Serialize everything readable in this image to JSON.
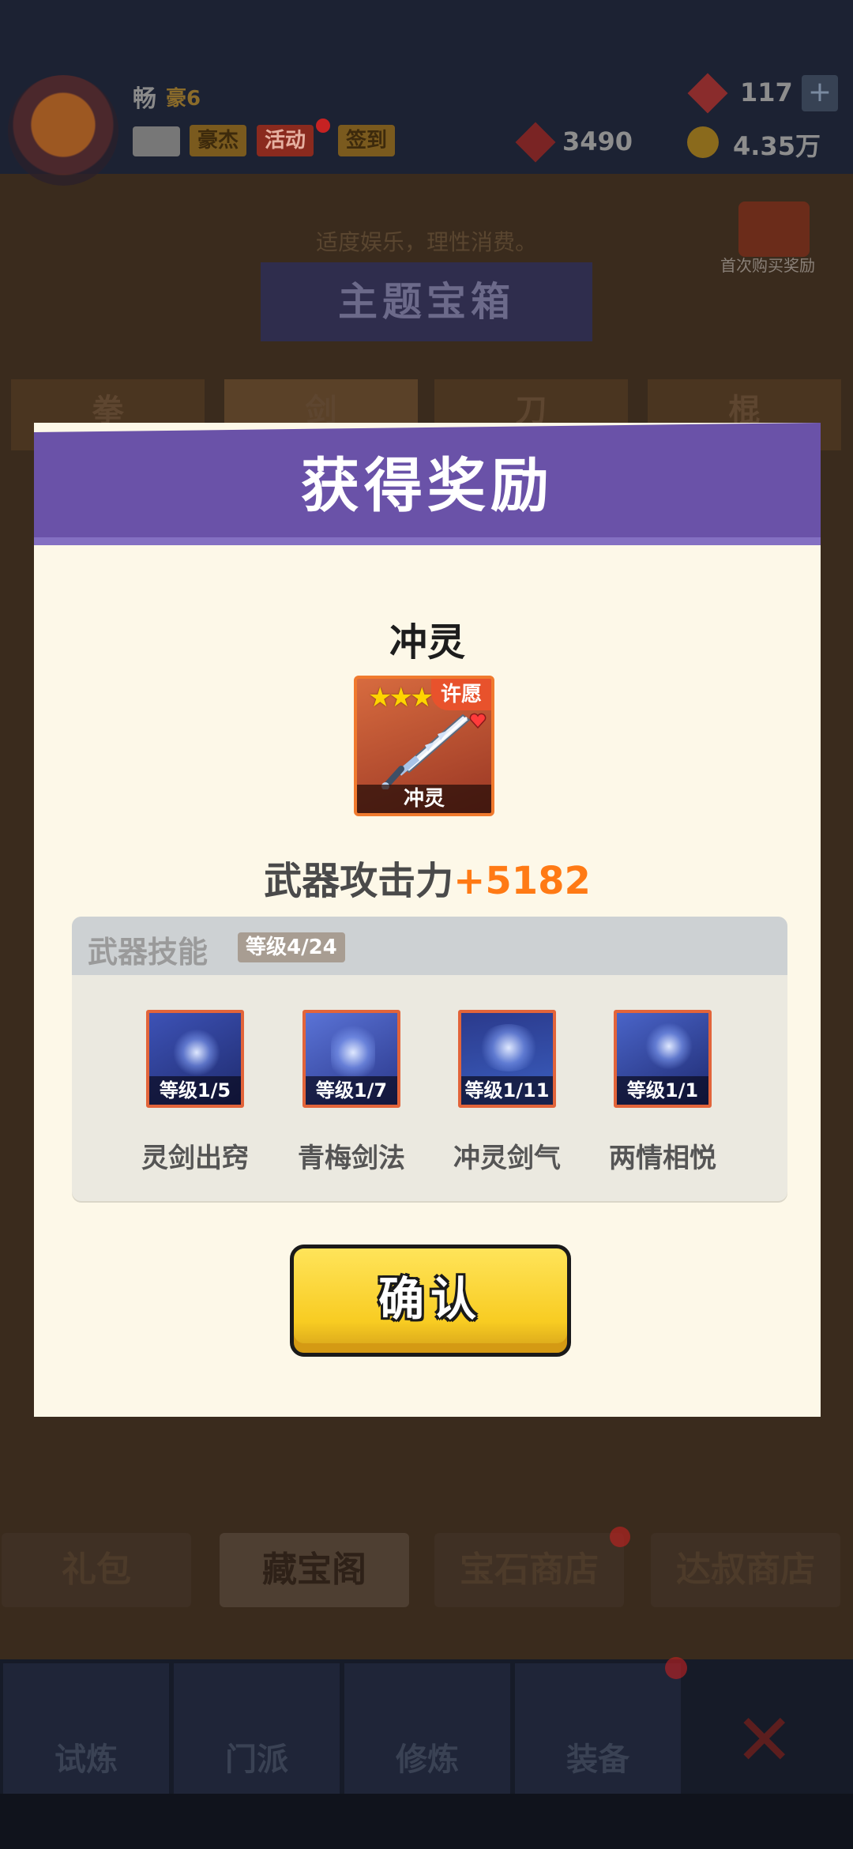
{
  "header": {
    "player_name": "畅",
    "vip_label": "豪6",
    "chips": [
      "豪杰",
      "活动",
      "签到"
    ],
    "gems": "117",
    "tokens": "3490",
    "coins": "4.35万",
    "plus_label": "+"
  },
  "background": {
    "notice": "适度娱乐，理性消费。",
    "first_buy_label": "首次购买奖励",
    "banner_title": "主题宝箱",
    "category_tabs": [
      "拳",
      "剑",
      "刀",
      "棍"
    ],
    "shop_tabs": [
      "礼包",
      "藏宝阁",
      "宝石商店",
      "达叔商店"
    ],
    "nav_items": [
      "试炼",
      "门派",
      "修炼",
      "装备"
    ]
  },
  "modal": {
    "title": "获得奖励",
    "item_name": "冲灵",
    "item_card_label": "冲灵",
    "wish_badge": "许愿",
    "stars": "★★★",
    "attack_label": "武器攻击力",
    "attack_value": "+5182",
    "skills_title": "武器技能",
    "skills_level": "等级4/24",
    "skills": [
      {
        "name": "灵剑出窍",
        "level": "等级1/5"
      },
      {
        "name": "青梅剑法",
        "level": "等级1/7"
      },
      {
        "name": "冲灵剑气",
        "level": "等级1/11"
      },
      {
        "name": "两情相悦",
        "level": "等级1/1"
      }
    ],
    "confirm_label": "确认"
  },
  "colors": {
    "header_purple": "#6a52a8",
    "modal_bg": "#fdf8e8",
    "attack_orange": "#ff7a15",
    "confirm_yellow": "#f8cc22",
    "card_border": "#f07a2e"
  }
}
